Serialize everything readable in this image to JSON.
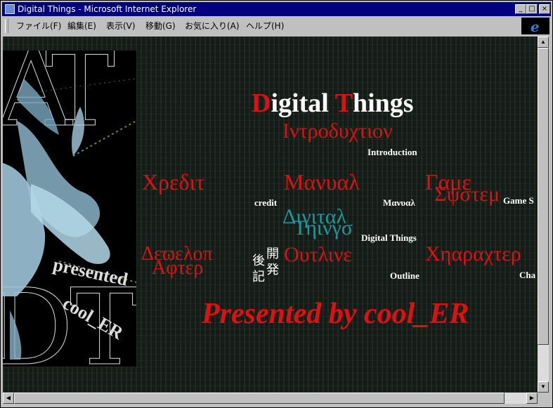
{
  "window": {
    "title": "Digital Things - Microsoft Internet Explorer",
    "minimize": "_",
    "maximize": "□",
    "close": "×"
  },
  "menu": [
    "ファイル(F)",
    "編集(E)",
    "表示(V)",
    "移動(G)",
    "お気に入り(A)",
    "ヘルプ(H)"
  ],
  "page": {
    "heading_d": "D",
    "heading_1": "igital ",
    "heading_t": "T",
    "heading_2": "hings",
    "intro_greek": "Ιντροδυχτιον",
    "intro_en": "Introduction",
    "credit_greek": "Χρεδιτ",
    "credit_en": "credit",
    "manual_greek": "Μανυαλ",
    "manual_en": "Μανυαλ",
    "game_greek_1": "Γαμε",
    "game_greek_2": "Σψστεμ",
    "game_en": "Game S",
    "dt_greek_1": "Διγιταλ",
    "dt_greek_2": "Τηινγσ",
    "dt_en": "Digital Things",
    "develop_greek": "Δεϖελοπ",
    "after_greek": "Αφτερ",
    "jp_1": "開",
    "jp_2": "後",
    "jp_3": "発",
    "jp_4": "記",
    "outline_greek": "Ουτλινε",
    "outline_en": "Outline",
    "char_greek": "Χηαραχτερ",
    "char_en": "Cha",
    "presented": "Presented by cool_ER"
  },
  "art": {
    "letter_a": "A",
    "letter_t": "T",
    "letter_d": "D",
    "letter_t2": "T",
    "overlay_1": "presented",
    "overlay_2": "cool_ER"
  },
  "scroll": {
    "up": "▲",
    "down": "▼",
    "left": "◀",
    "right": "▶"
  },
  "colors": {
    "red": "#dd1111",
    "teal": "#1a9aa0",
    "background": "#151c17",
    "titlebar": "#000080"
  }
}
